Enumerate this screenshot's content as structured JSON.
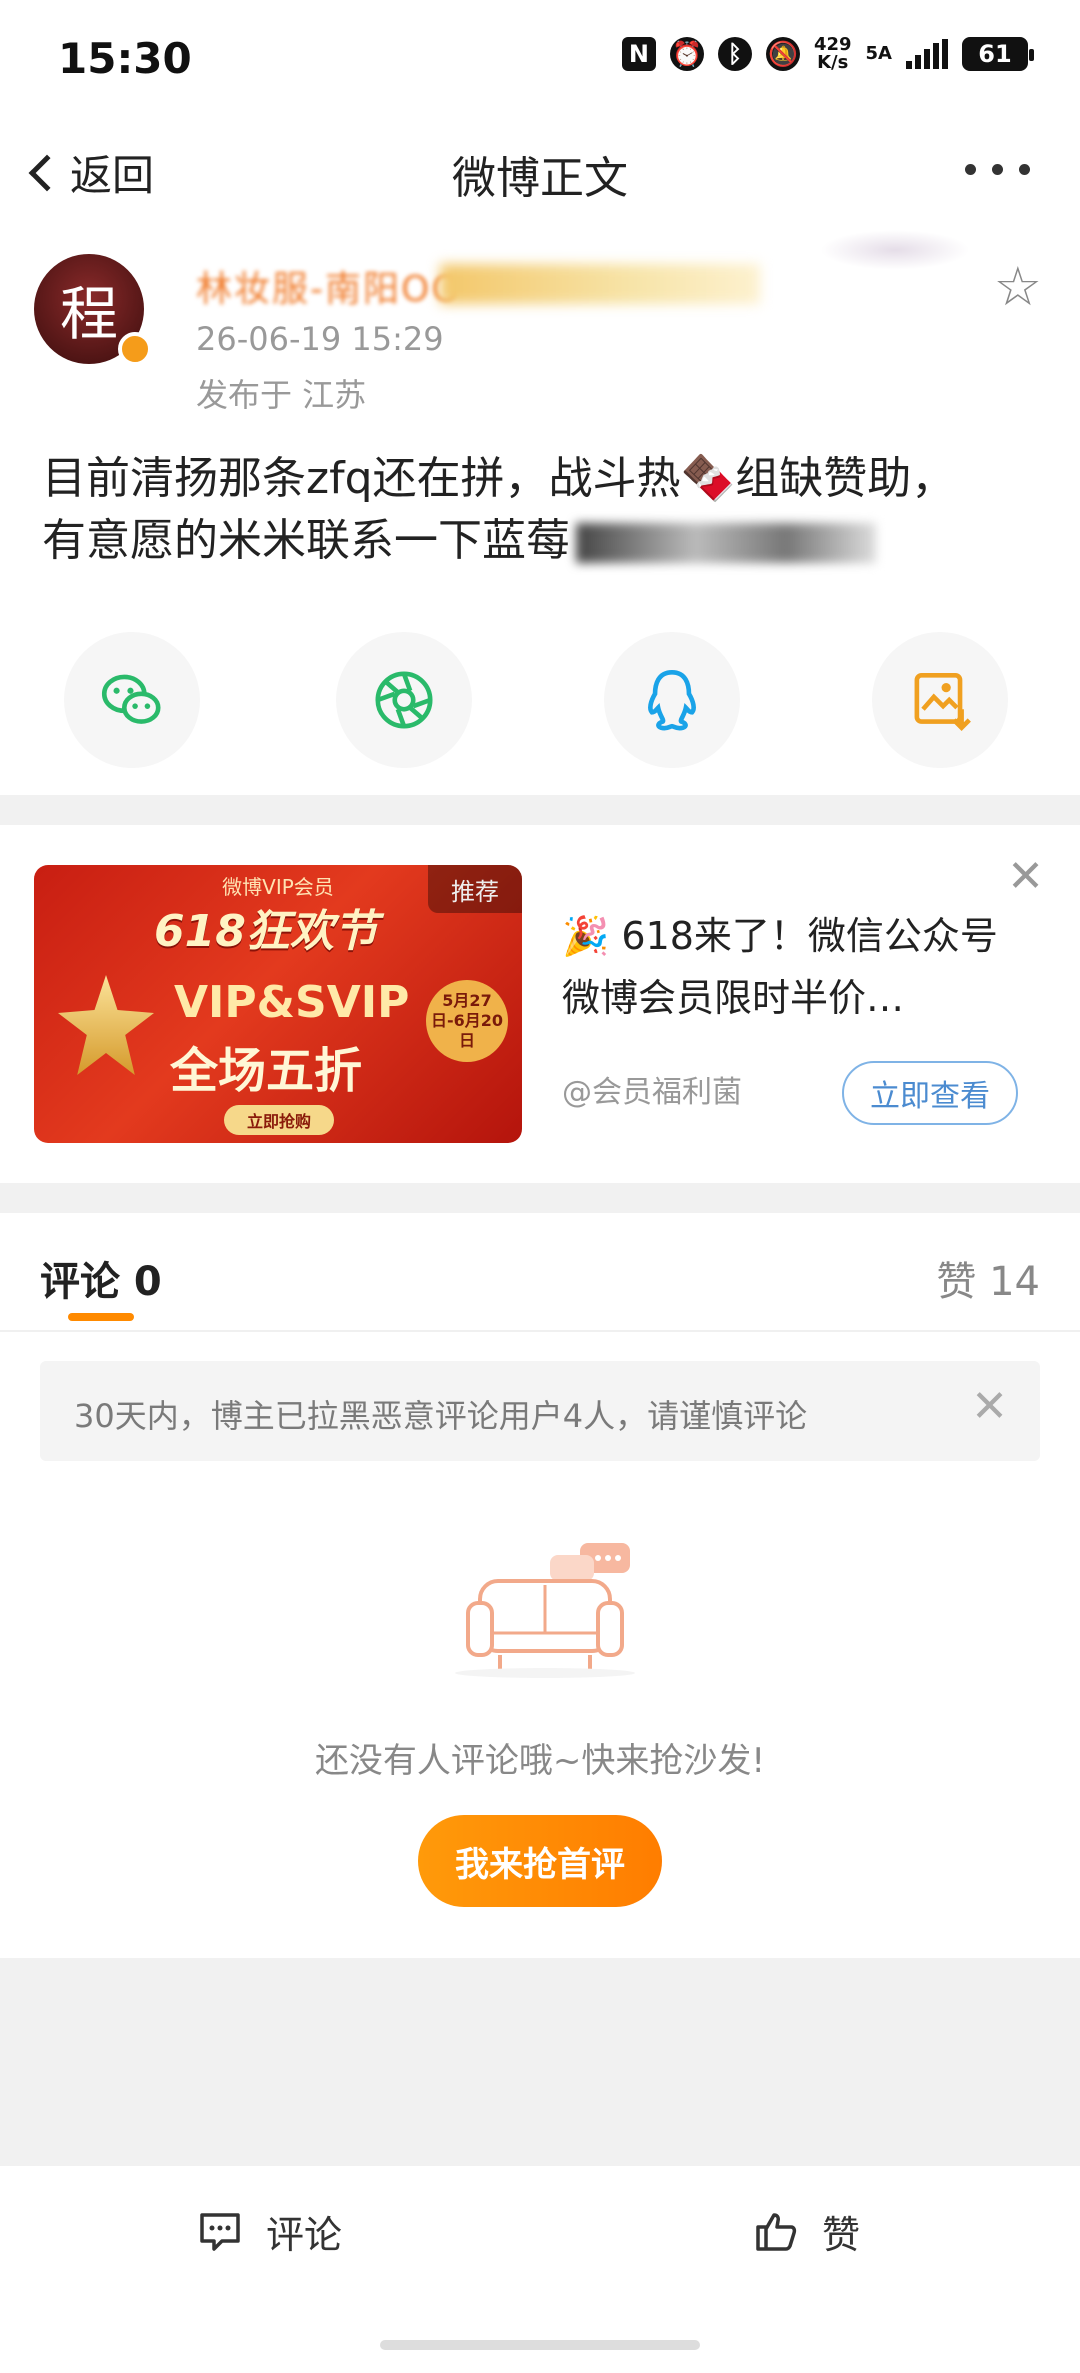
{
  "status": {
    "time": "15:30",
    "net_speed_value": "429",
    "net_speed_unit": "K/s",
    "network": "5A",
    "battery": "61"
  },
  "nav": {
    "back_label": "返回",
    "title": "微博正文"
  },
  "post": {
    "avatar_char": "程",
    "username": "林妆服-南阳OO",
    "time": "26-06-19 15:29",
    "location": "发布于 江苏",
    "text_line1": "目前清扬那条zfq还在拼，战斗热🍫组缺赞助，",
    "text_line2": "有意愿的米米联系一下蓝莓"
  },
  "share": {
    "icons": [
      "wechat-icon",
      "moments-icon",
      "qq-icon",
      "save-image-icon"
    ]
  },
  "ad": {
    "banner": {
      "top": "微博VIP会员",
      "festival": "618狂欢节",
      "vip": "VIP&SVIP",
      "half_price": "全场五折",
      "date": "5月27日-6月20日",
      "cta": "立即抢购"
    },
    "tag": "推荐",
    "title": "🎉 618来了！微信公众号微博会员限时半价…",
    "author": "@会员福利菌",
    "button": "立即查看"
  },
  "comments": {
    "tab_label": "评论 0",
    "likes_label": "赞 14",
    "notice": "30天内，博主已拉黑恶意评论用户4人，请谨慎评论",
    "empty_text": "还没有人评论哦~快来抢沙发!",
    "first_button": "我来抢首评"
  },
  "bottom": {
    "comment_label": "评论",
    "like_label": "赞"
  },
  "colors": {
    "accent": "#ff8a00",
    "link_blue": "#4b8bd0",
    "ad_red": "#c81e12"
  }
}
